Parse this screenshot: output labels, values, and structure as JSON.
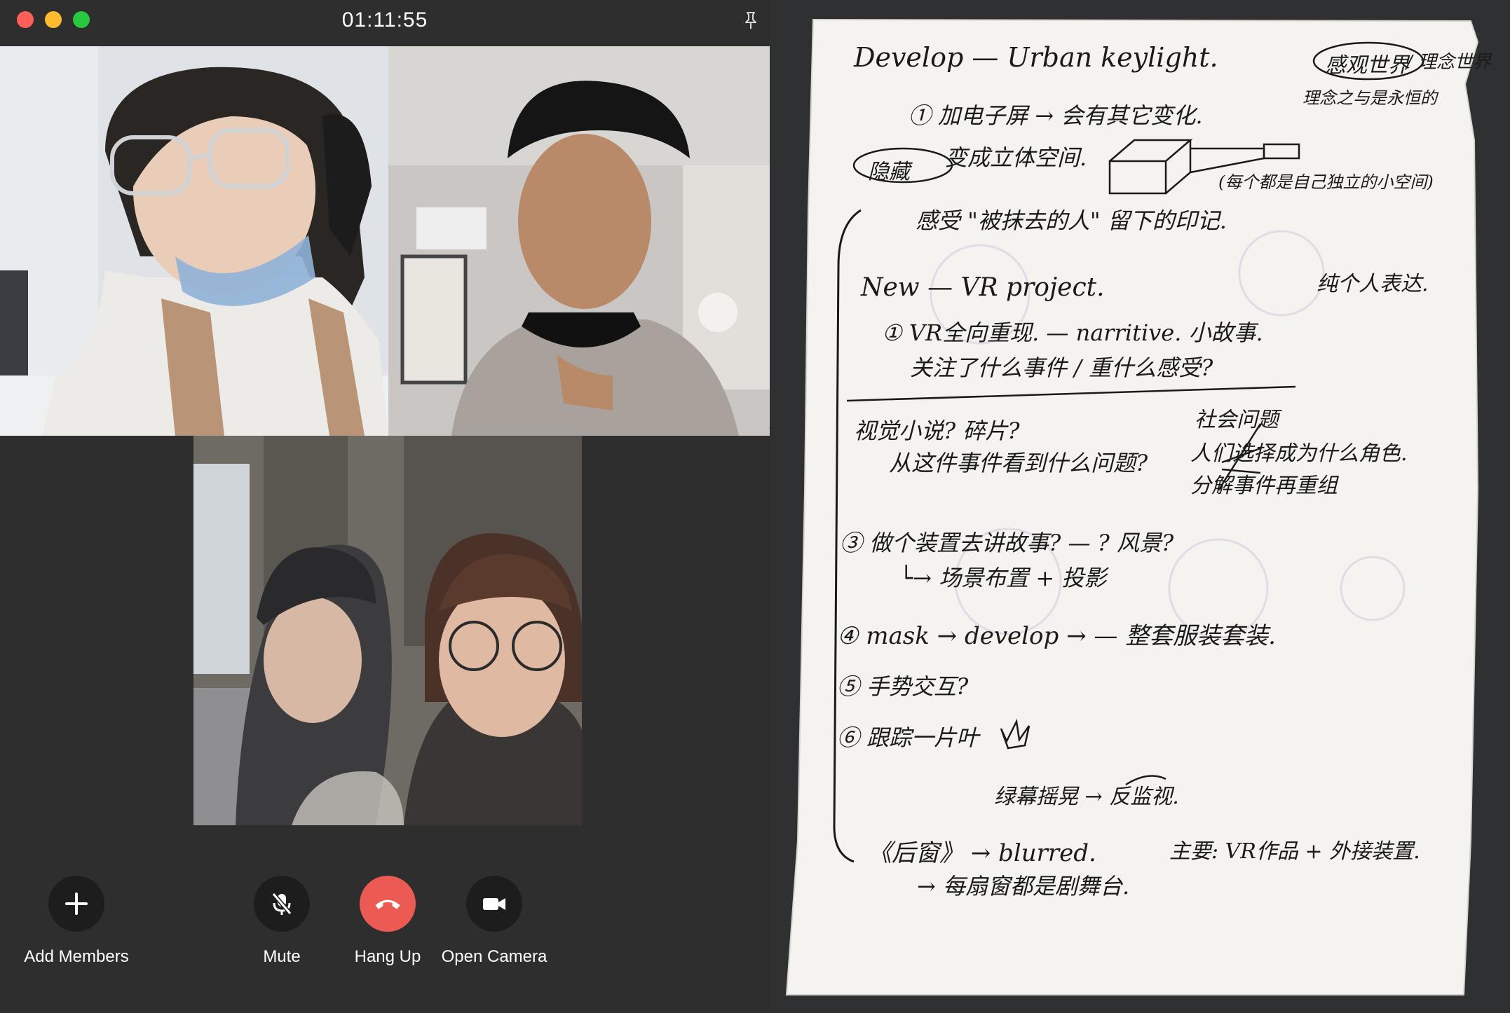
{
  "call": {
    "timer": "01:11:55",
    "controls": {
      "add_members": "Add Members",
      "mute": "Mute",
      "hang_up": "Hang Up",
      "open_camera": "Open Camera"
    },
    "colors": {
      "hang_up": "#eb5a53",
      "button_bg": "#1d1d1d",
      "window_bg": "#2e2e2e"
    }
  },
  "notes": {
    "line1": "Develop — Urban keylight.",
    "line1_circled": "感观世界",
    "line1_tail": "/ 理念世界",
    "line2": "理念之与是永恒的",
    "line3": "① 加电子屏 → 会有其它变化.",
    "line4_circled": "隐藏",
    "line4": "变成立体空间.",
    "line5": "(每个都是自己独立的小空间)",
    "line6": "感受 \"被抹去的人\" 留下的印记.",
    "line7": "New — VR project.",
    "line7_right": "纯个人表达.",
    "line8": "① VR全向重现. — narritive. 小故事.",
    "line9": "关注了什么事件 / 重什么感受?",
    "line10": "视觉小说? 碎片?",
    "line10_right": "社会问题",
    "line11": "从这件事件看到什么问题?",
    "line11_right": "人们选择成为什么角色.",
    "line12": "分解事件再重组",
    "line13": "③ 做个装置去讲故事? — ? 风景?",
    "line14": "└→ 场景布置 + 投影",
    "line15": "④ mask → develop → — 整套服装套装.",
    "line16": "⑤ 手势交互?",
    "line17": "⑥ 跟踪一片叶",
    "line18": "绿幕摇晃 → 反监视.",
    "line19": "《后窗》 → blurred.",
    "line19_right": "主要: VR作品 + 外接装置.",
    "line20": "→ 每扇窗都是剧舞台."
  }
}
